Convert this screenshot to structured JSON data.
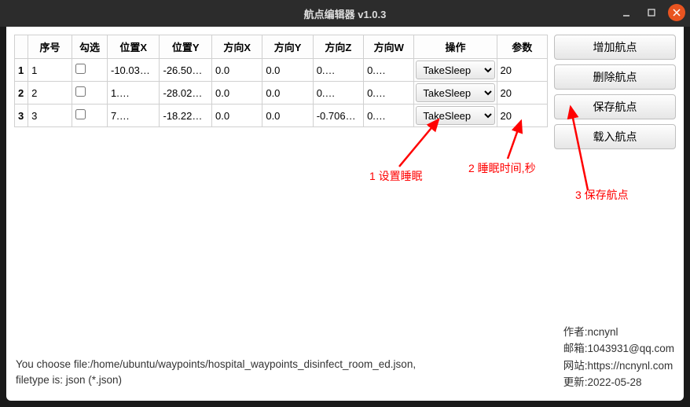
{
  "window": {
    "title": "航点编辑器 v1.0.3"
  },
  "headers": {
    "idx": "序号",
    "check": "勾选",
    "posx": "位置X",
    "posy": "位置Y",
    "dirx": "方向X",
    "diry": "方向Y",
    "dirz": "方向Z",
    "dirw": "方向W",
    "op": "操作",
    "param": "参数"
  },
  "rows": [
    {
      "n": "1",
      "idx": "1",
      "posx": "-10.03…",
      "posy": "-26.50…",
      "dirx": "0.0",
      "diry": "0.0",
      "dirz": "0.…",
      "dirw": "0.…",
      "op": "TakeSleep",
      "param": "20"
    },
    {
      "n": "2",
      "idx": "2",
      "posx": "1.…",
      "posy": "-28.02…",
      "dirx": "0.0",
      "diry": "0.0",
      "dirz": "0.…",
      "dirw": "0.…",
      "op": "TakeSleep",
      "param": "20"
    },
    {
      "n": "3",
      "idx": "3",
      "posx": "7.…",
      "posy": "-18.22…",
      "dirx": "0.0",
      "diry": "0.0",
      "dirz": "-0.706…",
      "dirw": "0.…",
      "op": "TakeSleep",
      "param": "20"
    }
  ],
  "actions": {
    "add": "增加航点",
    "del": "删除航点",
    "save": "保存航点",
    "load": "载入航点"
  },
  "annotations": {
    "a1": "1 设置睡眠",
    "a2": "2 睡眠时间,秒",
    "a3": "3 保存航点"
  },
  "footer": {
    "line1": "You choose file:/home/ubuntu/waypoints/hospital_waypoints_disinfect_room_ed.json,",
    "line2": "filetype is: json (*.json)"
  },
  "meta": {
    "author": "作者:ncnynl",
    "email": "邮箱:1043931@qq.com",
    "site": "网站:https://ncnynl.com",
    "update": "更新:2022-05-28"
  }
}
